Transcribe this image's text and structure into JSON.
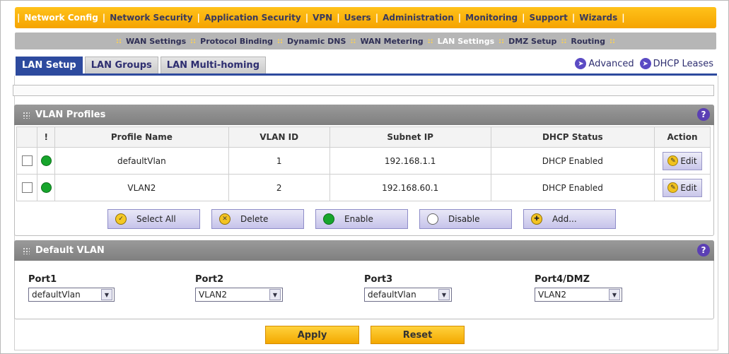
{
  "topnav": {
    "items": [
      "Network Config",
      "Network Security",
      "Application Security",
      "VPN",
      "Users",
      "Administration",
      "Monitoring",
      "Support",
      "Wizards"
    ],
    "active": "Network Config"
  },
  "subnav": {
    "items": [
      "WAN Settings",
      "Protocol Binding",
      "Dynamic DNS",
      "WAN Metering",
      "LAN Settings",
      "DMZ Setup",
      "Routing"
    ],
    "active": "LAN Settings"
  },
  "tabs": [
    "LAN Setup",
    "LAN Groups",
    "LAN Multi-homing"
  ],
  "links": {
    "advanced": "Advanced",
    "dhcp_leases": "DHCP Leases"
  },
  "vlan_profiles": {
    "title": "VLAN Profiles",
    "headers": {
      "status": "!",
      "profile_name": "Profile Name",
      "vlan_id": "VLAN ID",
      "subnet_ip": "Subnet IP",
      "dhcp_status": "DHCP Status",
      "action": "Action"
    },
    "rows": [
      {
        "profile_name": "defaultVlan",
        "vlan_id": "1",
        "subnet_ip": "192.168.1.1",
        "dhcp_status": "DHCP Enabled",
        "action": "Edit"
      },
      {
        "profile_name": "VLAN2",
        "vlan_id": "2",
        "subnet_ip": "192.168.60.1",
        "dhcp_status": "DHCP Enabled",
        "action": "Edit"
      }
    ]
  },
  "actions": {
    "select_all": "Select All",
    "delete": "Delete",
    "enable": "Enable",
    "disable": "Disable",
    "add": "Add..."
  },
  "default_vlan": {
    "title": "Default VLAN",
    "ports": [
      {
        "label": "Port1",
        "value": "defaultVlan"
      },
      {
        "label": "Port2",
        "value": "VLAN2"
      },
      {
        "label": "Port3",
        "value": "defaultVlan"
      },
      {
        "label": "Port4/DMZ",
        "value": "VLAN2"
      }
    ]
  },
  "buttons": {
    "apply": "Apply",
    "reset": "Reset"
  },
  "colors": {
    "top_menu": "#f5a300",
    "accent_blue": "#2d4a9e",
    "status_green": "#17a52c"
  }
}
